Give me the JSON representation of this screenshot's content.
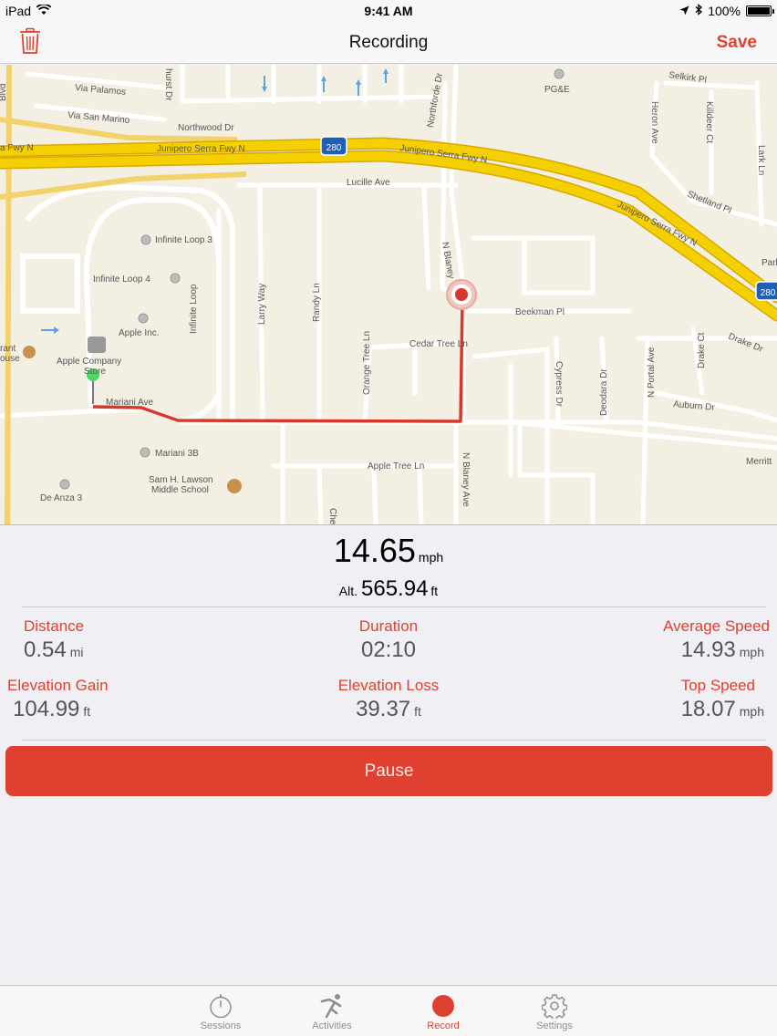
{
  "status_bar": {
    "device": "iPad",
    "time": "9:41 AM",
    "battery": "100%"
  },
  "nav": {
    "title": "Recording",
    "save_label": "Save"
  },
  "map": {
    "labels": {
      "junipero_serra_w": "Junipero Serra Fwy N",
      "junipero_serra_c": "Junipero Serra Fwy N",
      "junipero_serra_e": "Junipero Serra Fwy N",
      "i280_west": "280",
      "i280_east": "280",
      "via_palamos": "Via Palamos",
      "via_san_marino": "Via San Marino",
      "northwood": "Northwood Dr",
      "lucille": "Lucille Ave",
      "pge": "PG&E",
      "selkirk": "Selkirk Pl",
      "heron": "Heron Ave",
      "killdeer": "Killdeer Ct",
      "lark": "Lark Ln",
      "shetland": "Shetland Pl",
      "infinite_loop_3": "Infinite Loop 3",
      "infinite_loop_4": "Infinite Loop 4",
      "infinite_loop": "Infinite Loop",
      "apple_inc": "Apple Inc.",
      "apple_store_1": "Apple Company",
      "apple_store_2": "Store",
      "mariani_ave": "Mariani Ave",
      "mariani_3b": "Mariani 3B",
      "lawson_1": "Sam H. Lawson",
      "lawson_2": "Middle School",
      "de_anza_3": "De Anza 3",
      "larry_way": "Larry Way",
      "randy_ln": "Randy Ln",
      "orange_tree": "Orange Tree Ln",
      "cedar_tree": "Cedar Tree Ln",
      "beekman": "Beekman Pl",
      "n_blaney_top": "N Blaney",
      "n_blaney_bottom": "N Blaney Ave",
      "northforde": "Northforde Dr",
      "cypress": "Cypress Dr",
      "deodara": "Deodara Dr",
      "n_portal": "N Portal Ave",
      "drake_ct": "Drake Ct",
      "drake_dr": "Drake Dr",
      "auburn": "Auburn Dr",
      "apple_tree": "Apple Tree Ln",
      "merritt": "Merritt",
      "blvd": "Blvd",
      "park": "Park",
      "fwy_n_left": "a Fwy N",
      "restaurant_1": "rant",
      "restaurant_2": "ouse",
      "hurst": "hurst Dr",
      "che": "Che"
    }
  },
  "stats": {
    "speed": {
      "value": "14.65",
      "unit": "mph"
    },
    "altitude": {
      "label": "Alt.",
      "value": "565.94",
      "unit": "ft"
    },
    "distance": {
      "label": "Distance",
      "value": "0.54",
      "unit": "mi"
    },
    "duration": {
      "label": "Duration",
      "value": "02:10"
    },
    "average_speed": {
      "label": "Average Speed",
      "value": "14.93",
      "unit": "mph"
    },
    "elevation_gain": {
      "label": "Elevation Gain",
      "value": "104.99",
      "unit": "ft"
    },
    "elevation_loss": {
      "label": "Elevation Loss",
      "value": "39.37",
      "unit": "ft"
    },
    "top_speed": {
      "label": "Top Speed",
      "value": "18.07",
      "unit": "mph"
    }
  },
  "pause_label": "Pause",
  "tabs": [
    {
      "label": "Sessions",
      "icon": "stopwatch-icon"
    },
    {
      "label": "Activities",
      "icon": "runner-icon"
    },
    {
      "label": "Record",
      "icon": "record-icon",
      "active": true
    },
    {
      "label": "Settings",
      "icon": "gear-icon"
    }
  ],
  "colors": {
    "accent": "#e0402f",
    "route": "#d9372b",
    "freeway": "#f5d000",
    "start_pin": "#4cd964"
  }
}
